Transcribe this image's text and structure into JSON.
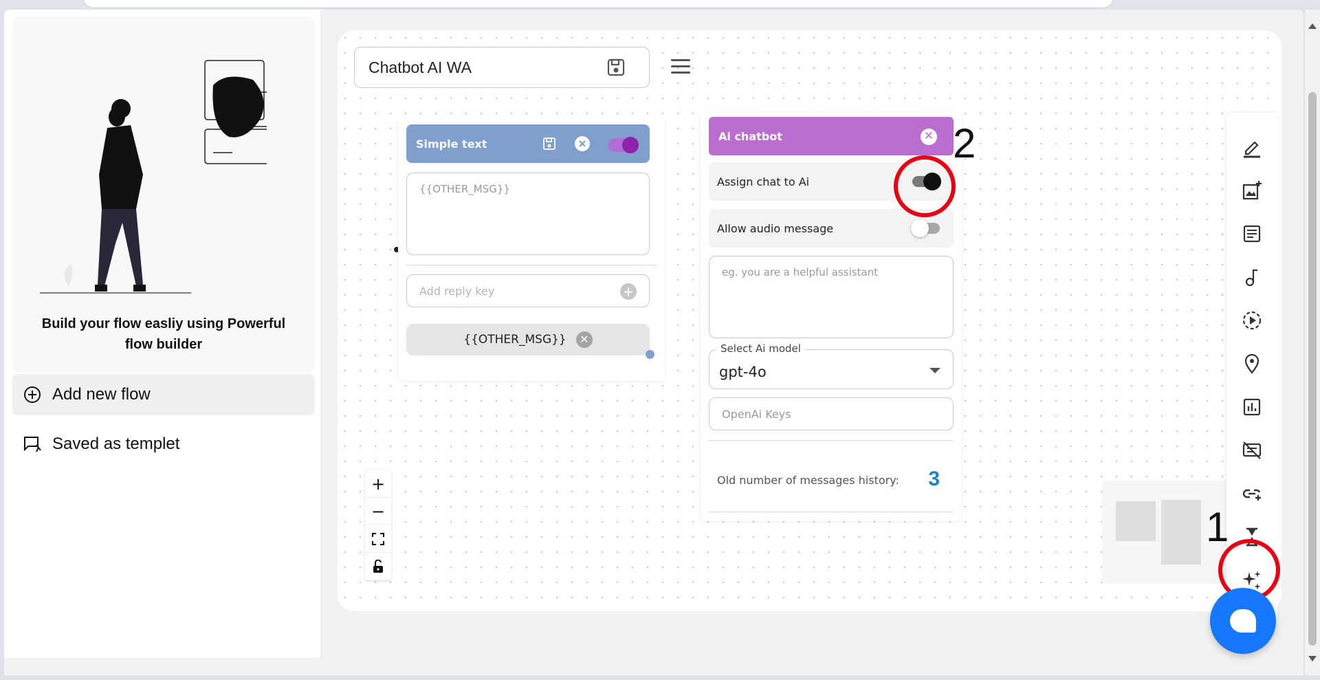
{
  "sidebar": {
    "promo_text": "Build your flow easliy using Powerful flow builder",
    "items": [
      {
        "label": "Add new flow",
        "icon": "add-circle-icon"
      },
      {
        "label": "Saved as templet",
        "icon": "saved-message-icon"
      }
    ]
  },
  "flow": {
    "title": "Chatbot AI WA"
  },
  "simple_text_node": {
    "title": "Simple text",
    "message_placeholder": "{{OTHER_MSG}}",
    "reply_key_placeholder": "Add reply key",
    "chip_label": "{{OTHER_MSG}}",
    "enabled": true
  },
  "ai_node": {
    "title": "Ai chatbot",
    "assign_label": "Assign chat to Ai",
    "assign_enabled": true,
    "audio_label": "Allow audio message",
    "audio_enabled": false,
    "prompt_placeholder": "eg. you are a helpful assistant",
    "model_legend": "Select Ai model",
    "model_value": "gpt-4o",
    "keys_placeholder": "OpenAi Keys",
    "history_label": "Old number of messages history:",
    "history_value": "3"
  },
  "zoom_controls": [
    "+",
    "−",
    "⛶",
    "🔓"
  ],
  "toolbar": [
    "edit-icon",
    "add-image-icon",
    "article-icon",
    "music-note-icon",
    "play-circle-icon",
    "location-pin-icon",
    "bar-chart-icon",
    "disabled-message-icon",
    "add-link-icon",
    "hourglass-icon",
    "sparkle-ai-icon"
  ],
  "annotations": [
    "1",
    "2"
  ],
  "colors": {
    "simple_header": "#7f9fcc",
    "ai_header": "#b96ed0",
    "annotation": "#e60012",
    "chat_bubble": "#1677ff",
    "history_number": "#1a7fc8"
  }
}
